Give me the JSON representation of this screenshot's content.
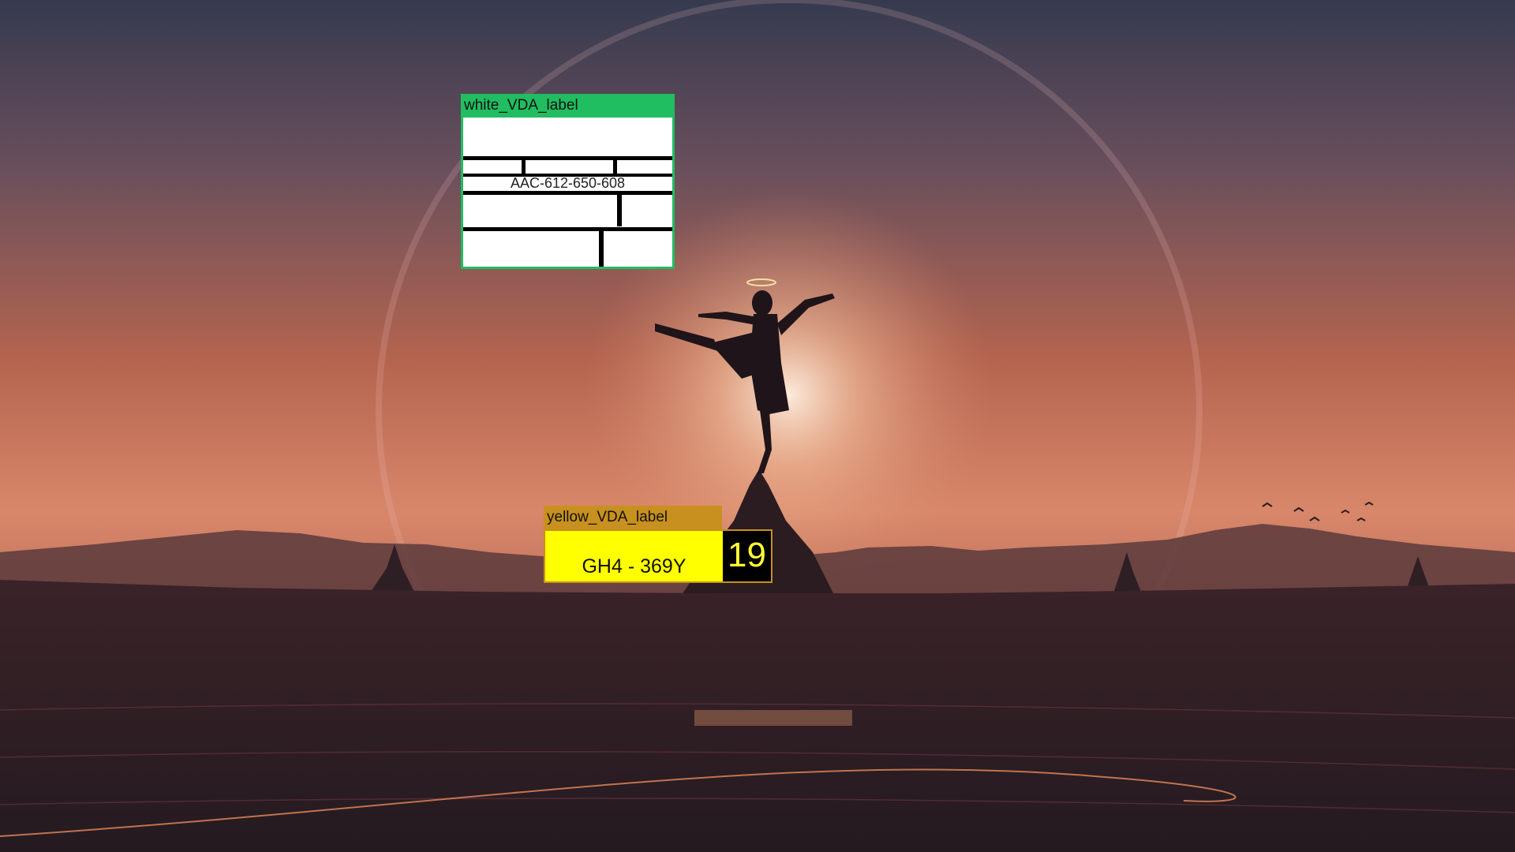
{
  "background": {
    "description_icon": "sunset-ballerina-wallpaper",
    "colors": {
      "sky_top": "#3a3d52",
      "sky_mid": "#b4604d",
      "sky_glow": "#f8c9a8",
      "ground": "#2e1f24"
    }
  },
  "white_label": {
    "title": "white_VDA_label",
    "code": "AAC-612-650-608",
    "title_color": "#21bd61"
  },
  "yellow_label": {
    "title": "yellow_VDA_label",
    "code": "GH4 - 369Y",
    "badge": "19",
    "title_color": "#c8901e",
    "plate_color": "#ffff00"
  }
}
